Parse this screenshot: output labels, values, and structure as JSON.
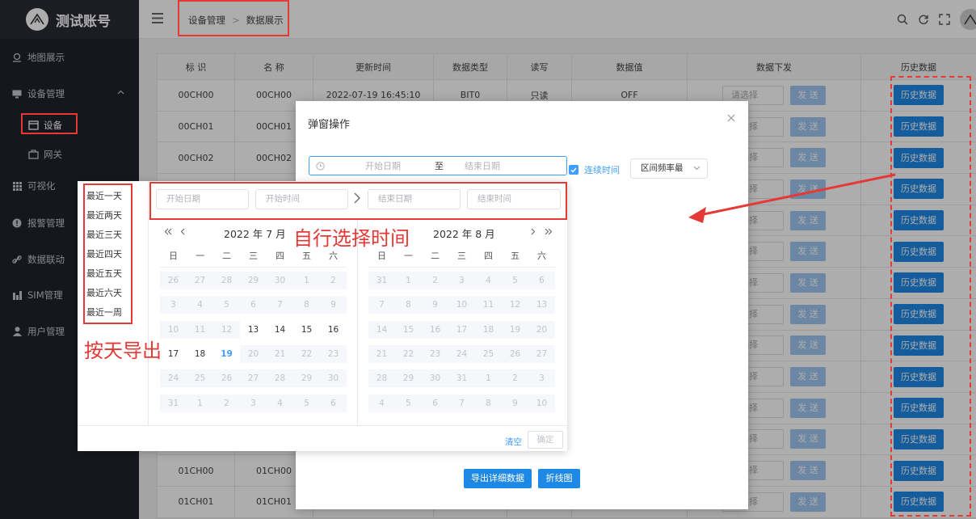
{
  "brand": {
    "name": "测试账号"
  },
  "sidebar": {
    "items": [
      {
        "label": "地图展示"
      },
      {
        "label": "设备管理"
      },
      {
        "label": "设备"
      },
      {
        "label": "网关"
      },
      {
        "label": "可视化"
      },
      {
        "label": "报警管理"
      },
      {
        "label": "数据联动"
      },
      {
        "label": "SIM管理"
      },
      {
        "label": "用户管理"
      }
    ]
  },
  "breadcrumb": {
    "parent": "设备管理",
    "sep": ">",
    "current": "数据展示"
  },
  "table": {
    "headers": [
      "标 识",
      "名 称",
      "更新时间",
      "数据类型",
      "读写",
      "数据值",
      "数据下发",
      "历史数据"
    ],
    "rows": [
      {
        "id": "00CH00",
        "name": "00CH00",
        "time": "2022-07-19 16:45:10",
        "type": "BIT0",
        "rw": "只读",
        "value": "OFF"
      },
      {
        "id": "00CH01",
        "name": "00CH01"
      },
      {
        "id": "00CH02",
        "name": "00CH02"
      },
      {
        "id": "",
        "name": ""
      },
      {
        "id": "",
        "name": ""
      },
      {
        "id": "",
        "name": ""
      },
      {
        "id": "",
        "name": ""
      },
      {
        "id": "",
        "name": ""
      },
      {
        "id": "",
        "name": ""
      },
      {
        "id": "",
        "name": ""
      },
      {
        "id": "",
        "name": ""
      },
      {
        "id": "",
        "name": ""
      },
      {
        "id": "01CH00",
        "name": "01CH00"
      },
      {
        "id": "01CH01",
        "name": "01CH01"
      }
    ],
    "select_placeholder": "请选择",
    "send_label": "发 送",
    "history_label": "历史数据"
  },
  "dialog": {
    "title": "弹窗操作",
    "range_start": "开始日期",
    "range_to": "至",
    "range_end": "结束日期",
    "continuous": "连续时间",
    "interval": "区间频率最",
    "export_btn": "导出详细数据",
    "chart_btn": "折线图"
  },
  "picker": {
    "shortcuts": [
      "最近一天",
      "最近两天",
      "最近三天",
      "最近四天",
      "最近五天",
      "最近六天",
      "最近一周"
    ],
    "start_date": "开始日期",
    "start_time": "开始时间",
    "end_date": "结束日期",
    "end_time": "结束时间",
    "left_month": "2022 年 7 月",
    "right_month": "2022 年 8 月",
    "weekdays": [
      "日",
      "一",
      "二",
      "三",
      "四",
      "五",
      "六"
    ],
    "left_days": [
      "26",
      "27",
      "28",
      "29",
      "30",
      "1",
      "2",
      "3",
      "4",
      "5",
      "6",
      "7",
      "8",
      "9",
      "10",
      "11",
      "12",
      "13",
      "14",
      "15",
      "16",
      "17",
      "18",
      "19",
      "20",
      "21",
      "22",
      "23",
      "24",
      "25",
      "26",
      "27",
      "28",
      "29",
      "30",
      "31",
      "1",
      "2",
      "3",
      "4",
      "5",
      "6"
    ],
    "left_current": [
      13,
      14,
      15,
      16,
      17,
      18
    ],
    "left_today": 19,
    "right_days": [
      "31",
      "1",
      "2",
      "3",
      "4",
      "5",
      "6",
      "7",
      "8",
      "9",
      "10",
      "11",
      "12",
      "13",
      "14",
      "15",
      "16",
      "17",
      "18",
      "19",
      "20",
      "21",
      "22",
      "23",
      "24",
      "25",
      "26",
      "27",
      "28",
      "29",
      "30",
      "31",
      "1",
      "2",
      "3",
      "4",
      "5",
      "6",
      "7",
      "8",
      "9",
      "10"
    ],
    "clear": "清空",
    "ok": "确定"
  },
  "annotations": {
    "custom_time": "自行选择时间",
    "by_day": "按天导出"
  },
  "colors": {
    "sidebar": "#20222a",
    "primary": "#1e88e5",
    "annotation": "#e53935",
    "link": "#409eff"
  }
}
